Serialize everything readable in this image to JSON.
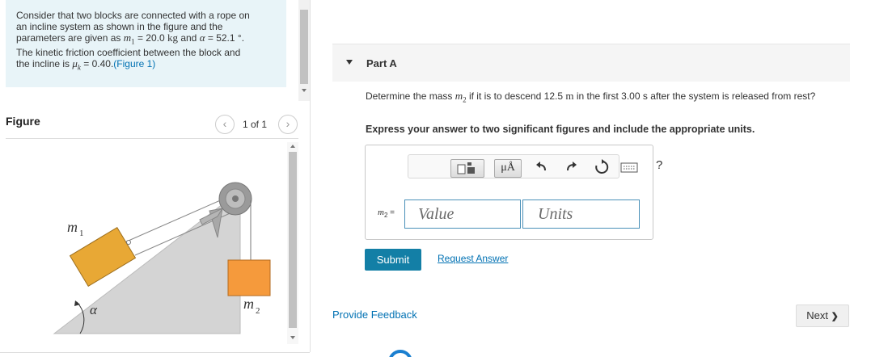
{
  "problem": {
    "line1": "Consider that two blocks are connected with a rope on",
    "line2": "an incline system as shown in the figure and the",
    "line3_prefix": "parameters are given as ",
    "m1_symbol": "m",
    "m1_sub": "1",
    "m1_eq": " = 20.0 ",
    "m1_unit": "kg",
    "and": " and ",
    "alpha_symbol": "α",
    "alpha_eq": " = 52.1 °.",
    "line4": "The kinetic friction coefficient between the block and",
    "line5_prefix": "the incline is ",
    "mu_symbol": "μ",
    "mu_sub": "k",
    "mu_eq": " = 0.40.",
    "figure_link": "(Figure 1)"
  },
  "figure": {
    "title": "Figure",
    "count": "1 of 1",
    "prev_glyph": "‹",
    "next_glyph": "›",
    "labels": {
      "m1": "m",
      "m1_sub": "1",
      "m2": "m",
      "m2_sub": "2",
      "alpha": "α"
    },
    "colors": {
      "block1": "#e8a835",
      "block2": "#f59a3c",
      "incline": "#d4d4d4",
      "pulley": "#9a9a9a"
    }
  },
  "part": {
    "title": "Part A",
    "question_prefix": "Determine the mass ",
    "m2_symbol": "m",
    "m2_sub": "2",
    "question_mid": " if it is to descend 12.5 ",
    "unit_m": "m",
    "question_suffix": " in the first 3.00 s after the system is released from rest?",
    "instruction": "Express your answer to two significant figures and include the appropriate units."
  },
  "answer": {
    "variable": "m",
    "variable_sub": "2",
    "equals": " =",
    "value_placeholder": "Value",
    "units_placeholder": "Units",
    "toolbar": {
      "template_icon": "template-icon",
      "units_button": "μÅ",
      "undo_icon": "undo-icon",
      "redo_icon": "redo-icon",
      "reset_icon": "reset-icon",
      "keyboard_icon": "keyboard-icon",
      "help": "?"
    }
  },
  "actions": {
    "submit": "Submit",
    "request": "Request Answer",
    "feedback": "Provide Feedback",
    "next": "Next",
    "next_glyph": "❯"
  },
  "colors": {
    "accent": "#137fa6",
    "link": "#0071b3",
    "problem_bg": "#e8f4f8",
    "input_border": "#4a90b8"
  }
}
